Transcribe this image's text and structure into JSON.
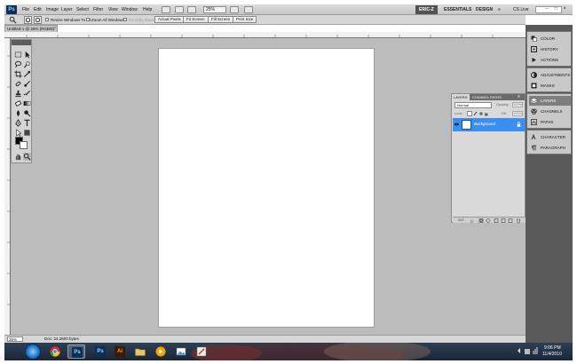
{
  "app": {
    "logo": "Ps"
  },
  "menu": [
    "File",
    "Edit",
    "Image",
    "Layer",
    "Select",
    "Filter",
    "View",
    "Window",
    "Help"
  ],
  "toolbar": {
    "zoom": "25%"
  },
  "workspaces": {
    "user": "ERIC-Z",
    "essentials": "ESSENTIALS",
    "design": "DESIGN",
    "more": "»"
  },
  "cslive": "CS Live",
  "window_controls": {
    "minimize": "–",
    "maximize": "□",
    "close": "×"
  },
  "options": {
    "resize_windows": "Resize Windows To Fit",
    "zoom_all": "Zoom All Windows",
    "scrubby": "Scrubby Zoom",
    "actual_pixels": "Actual Pixels",
    "fit_screen": "Fit Screen",
    "fill_screen": "Fill Screen",
    "print_size": "Print Size"
  },
  "document_tab": {
    "title": "Untitled-1 @ 25% (RGB/8)",
    "close": "×"
  },
  "status": {
    "zoom": "25%",
    "doc": "Doc: 24.2M/0 bytes"
  },
  "layers_panel": {
    "tabs": [
      "LAYERS",
      "CHANNEL",
      "PATHS"
    ],
    "blend_mode": "Normal",
    "opacity_label": "Opacity:",
    "opacity": "100%",
    "lock_label": "Lock:",
    "fill_label": "Fill:",
    "fill": "100%",
    "layer_name": "Background",
    "footer_link": "GO"
  },
  "dock": {
    "group1": [
      "COLOR",
      "HISTORY",
      "ACTIONS"
    ],
    "group2": [
      "ADJUSTMENTS",
      "MASKS"
    ],
    "group3": [
      "LAYERS",
      "CHANNELS",
      "PATHS"
    ],
    "group4": [
      "CHARACTER",
      "PARAGRAPH"
    ]
  },
  "taskbar": {
    "photoshop_glyph": "Ps",
    "photoshop2_glyph": "Ps",
    "illustrator_glyph": "Ai",
    "time": "9:06 PM",
    "date": "11/4/2010"
  },
  "colors": {
    "accent": "#3a8ef0",
    "dock": "#595959",
    "canvas": "#bcbcbc"
  }
}
